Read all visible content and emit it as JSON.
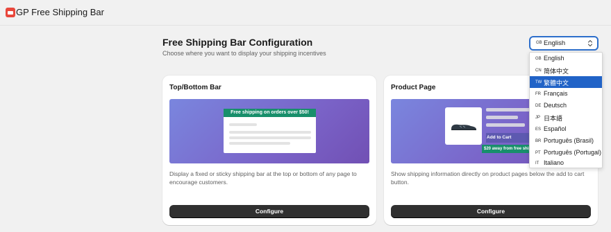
{
  "app": {
    "title": "GP Free Shipping Bar",
    "logo_icon": "app-logo-icon"
  },
  "header": {
    "title": "Free Shipping Bar Configuration",
    "subtitle": "Choose where you want to display your shipping incentives"
  },
  "language": {
    "selected_code": "GB",
    "selected_label": "English",
    "options": [
      {
        "code": "GB",
        "label": "English"
      },
      {
        "code": "CN",
        "label": "简体中文"
      },
      {
        "code": "TW",
        "label": "繁體中文"
      },
      {
        "code": "FR",
        "label": "Français"
      },
      {
        "code": "DE",
        "label": "Deutsch"
      },
      {
        "code": "JP",
        "label": "日本語"
      },
      {
        "code": "ES",
        "label": "Español"
      },
      {
        "code": "BR",
        "label": "Português (Brasil)"
      },
      {
        "code": "PT",
        "label": "Português (Portugal)"
      },
      {
        "code": "IT",
        "label": "Italiano"
      }
    ],
    "highlighted_index": 2
  },
  "cards": [
    {
      "title": "Top/Bottom Bar",
      "preview_bar_text": "Free shipping on orders over $50!",
      "description": "Display a fixed or sticky shipping bar at the top or bottom of any page to encourage customers.",
      "button_label": "Configure"
    },
    {
      "title": "Product Page",
      "add_to_cart_text": "Add to Cart",
      "preview_bar_text": "$20 away from free shipping",
      "description": "Show shipping information directly on product pages below the add to cart button.",
      "button_label": "Configure"
    }
  ],
  "colors": {
    "accent": "#2c6ecb",
    "highlight": "#2163c7",
    "button": "#303030",
    "shipping_bar": "#188f6b",
    "brand": "#e8473b"
  }
}
